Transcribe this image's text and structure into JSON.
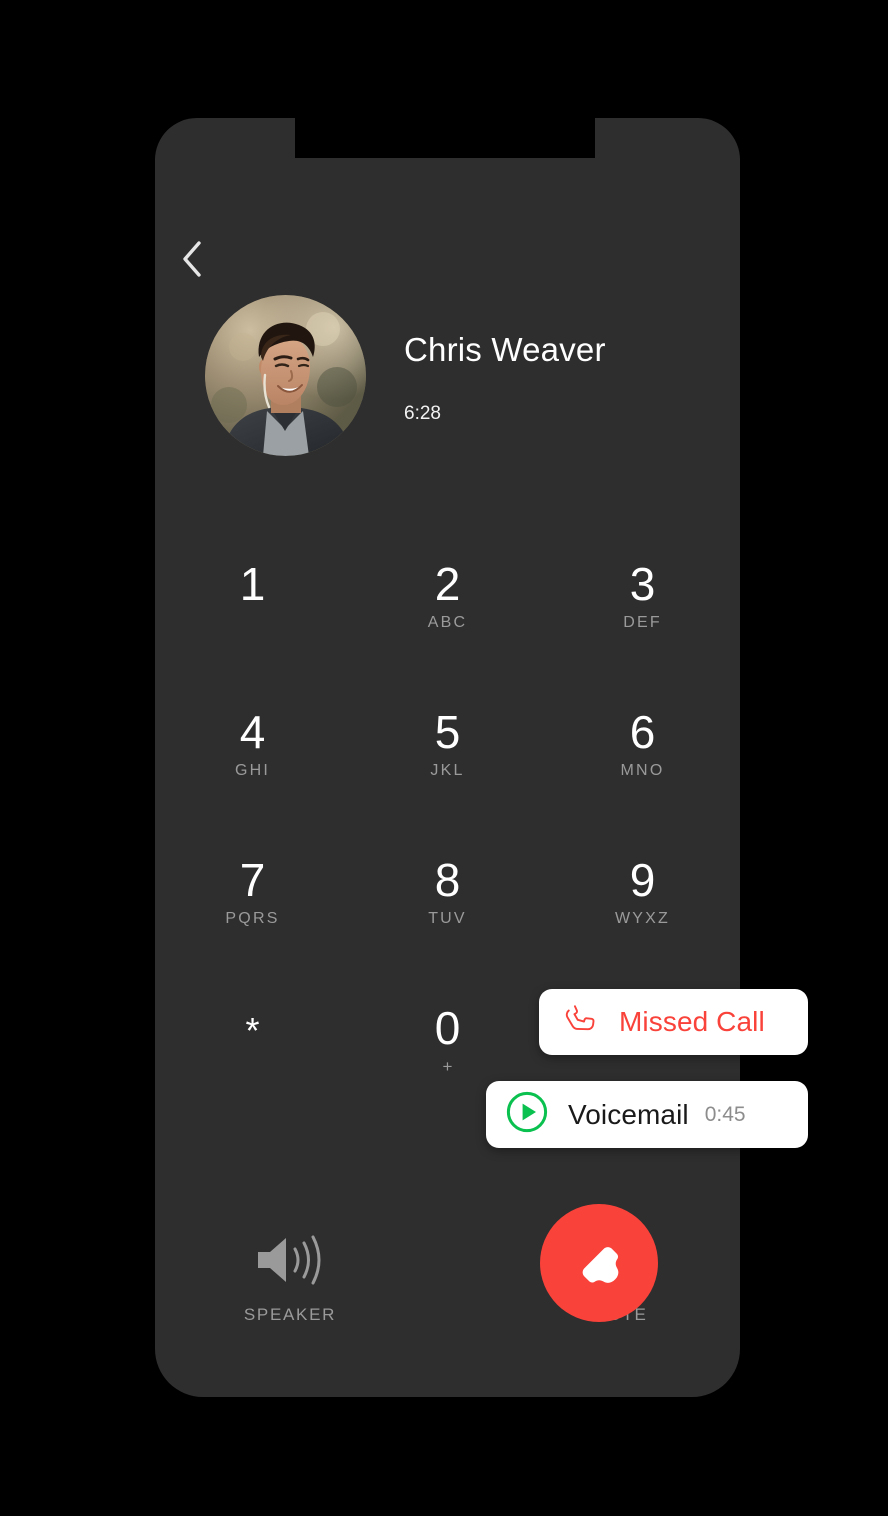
{
  "app": {
    "screen_name": "In-Call Keypad",
    "background_color": "#000000",
    "device_body_color": "#2e2e2e"
  },
  "nav": {
    "back_icon": "chevron-left-icon"
  },
  "contact": {
    "avatar_icon": "contact-avatar-photo",
    "name": "Chris Weaver",
    "call_duration": "6:28"
  },
  "keypad": {
    "rows": [
      [
        {
          "digit": "1",
          "letters": ""
        },
        {
          "digit": "2",
          "letters": "ABC"
        },
        {
          "digit": "3",
          "letters": "DEF"
        }
      ],
      [
        {
          "digit": "4",
          "letters": "GHI"
        },
        {
          "digit": "5",
          "letters": "JKL"
        },
        {
          "digit": "6",
          "letters": "MNO"
        }
      ],
      [
        {
          "digit": "7",
          "letters": "PQRS"
        },
        {
          "digit": "8",
          "letters": "TUV"
        },
        {
          "digit": "9",
          "letters": "WYXZ"
        }
      ],
      [
        {
          "digit": "*",
          "letters": ""
        },
        {
          "digit": "0",
          "letters": "+"
        },
        {
          "digit": "#",
          "letters": ""
        }
      ]
    ]
  },
  "notifications": [
    {
      "id": "missed-call",
      "icon": "phone-handset-outline-icon",
      "icon_color": "#f9423a",
      "label": "Missed Call",
      "label_color": "#f9423a",
      "duration": ""
    },
    {
      "id": "voicemail",
      "icon": "play-circle-icon",
      "icon_color": "#0ac04f",
      "label": "Voicemail",
      "label_color": "#1a1a1a",
      "duration": "0:45"
    }
  ],
  "controls": {
    "speaker": {
      "icon": "speaker-volume-icon",
      "label": "SPEAKER"
    },
    "end_call": {
      "icon": "end-call-handset-icon",
      "label": "",
      "color": "#f9423a"
    },
    "mute": {
      "icon": "microphone-muted-icon",
      "label": "MUTE"
    }
  }
}
